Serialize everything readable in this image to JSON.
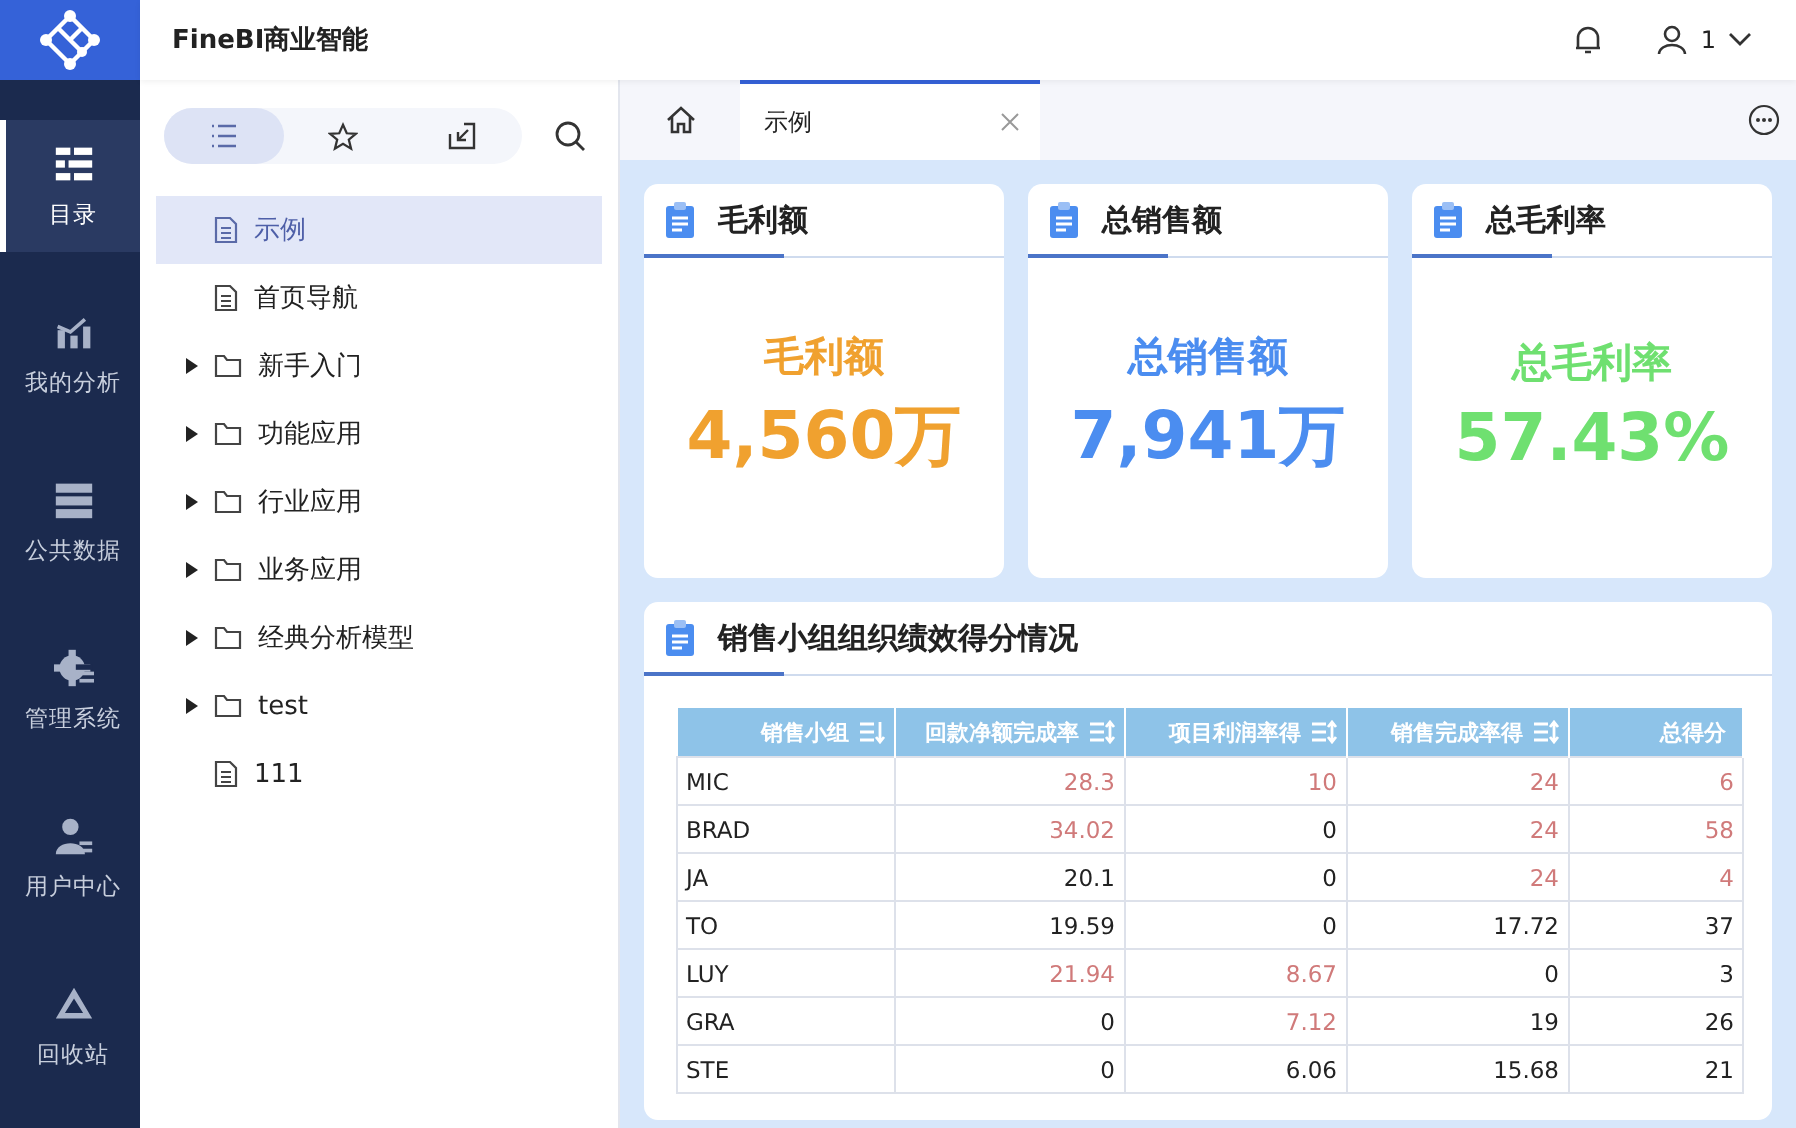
{
  "header": {
    "title": "FineBI商业智能",
    "user": "1"
  },
  "nav": [
    {
      "label": "目录",
      "selected": true
    },
    {
      "label": "我的分析",
      "selected": false
    },
    {
      "label": "公共数据",
      "selected": false
    },
    {
      "label": "管理系统",
      "selected": false
    },
    {
      "label": "用户中心",
      "selected": false
    },
    {
      "label": "回收站",
      "selected": false
    }
  ],
  "catalog_tabs": [
    {
      "selected": true
    },
    {
      "selected": false
    },
    {
      "selected": false
    }
  ],
  "tree": [
    {
      "label": "示例",
      "kind": "file",
      "selected": true
    },
    {
      "label": "首页导航",
      "kind": "file",
      "selected": false
    },
    {
      "label": "新手入门",
      "kind": "folder",
      "selected": false,
      "expanded": false
    },
    {
      "label": "功能应用",
      "kind": "folder",
      "selected": false,
      "expanded": false
    },
    {
      "label": "行业应用",
      "kind": "folder",
      "selected": false,
      "expanded": false
    },
    {
      "label": "业务应用",
      "kind": "folder",
      "selected": false,
      "expanded": false
    },
    {
      "label": "经典分析模型",
      "kind": "folder",
      "selected": false,
      "expanded": false
    },
    {
      "label": "test",
      "kind": "folder",
      "selected": false,
      "expanded": false
    },
    {
      "label": "111",
      "kind": "file",
      "selected": false
    }
  ],
  "tabs": [
    {
      "label": "示例",
      "selected": true
    }
  ],
  "kpis": [
    {
      "title": "毛利额",
      "label": "毛利额",
      "value": "4,560万",
      "color": "#f0a12f"
    },
    {
      "title": "总销售额",
      "label": "总销售额",
      "value": "7,941万",
      "color": "#4b8df0"
    },
    {
      "title": "总毛利率",
      "label": "总毛利率",
      "value": "57.43%",
      "color": "#6fe070"
    }
  ],
  "table": {
    "title": "销售小组组织绩效得分情况",
    "columns": [
      "销售小组",
      "回款净额完成率",
      "项目利润率得",
      "销售完成率得",
      "总得分"
    ],
    "rows": [
      [
        {
          "text": "MIC",
          "flagged": false
        },
        {
          "text": "28.3",
          "flagged": true
        },
        {
          "text": "10",
          "flagged": true
        },
        {
          "text": "24",
          "flagged": true
        },
        {
          "text": "6",
          "flagged": true
        }
      ],
      [
        {
          "text": "BRAD",
          "flagged": false
        },
        {
          "text": "34.02",
          "flagged": true
        },
        {
          "text": "0",
          "flagged": false
        },
        {
          "text": "24",
          "flagged": true
        },
        {
          "text": "58",
          "flagged": true
        }
      ],
      [
        {
          "text": "JA",
          "flagged": false
        },
        {
          "text": "20.1",
          "flagged": false
        },
        {
          "text": "0",
          "flagged": false
        },
        {
          "text": "24",
          "flagged": true
        },
        {
          "text": "4",
          "flagged": true
        }
      ],
      [
        {
          "text": "TO",
          "flagged": false
        },
        {
          "text": "19.59",
          "flagged": false
        },
        {
          "text": "0",
          "flagged": false
        },
        {
          "text": "17.72",
          "flagged": false
        },
        {
          "text": "37",
          "flagged": false
        }
      ],
      [
        {
          "text": "LUY",
          "flagged": false
        },
        {
          "text": "21.94",
          "flagged": true
        },
        {
          "text": "8.67",
          "flagged": true
        },
        {
          "text": "0",
          "flagged": false
        },
        {
          "text": "3",
          "flagged": false
        }
      ],
      [
        {
          "text": "GRA",
          "flagged": false
        },
        {
          "text": "0",
          "flagged": false
        },
        {
          "text": "7.12",
          "flagged": true
        },
        {
          "text": "19",
          "flagged": false
        },
        {
          "text": "26",
          "flagged": false
        }
      ],
      [
        {
          "text": "STE",
          "flagged": false
        },
        {
          "text": "0",
          "flagged": false
        },
        {
          "text": "6.06",
          "flagged": false
        },
        {
          "text": "15.68",
          "flagged": false
        },
        {
          "text": "21",
          "flagged": false
        }
      ]
    ]
  }
}
